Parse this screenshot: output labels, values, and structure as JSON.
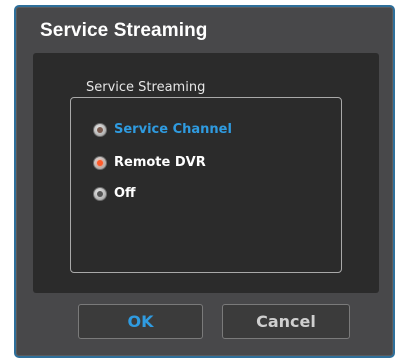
{
  "dialog": {
    "title": "Service Streaming",
    "group_label": "Service Streaming",
    "options": [
      {
        "label": "Service Channel",
        "state": "focused"
      },
      {
        "label": "Remote DVR",
        "state": "selected"
      },
      {
        "label": "Off",
        "state": "unselected"
      }
    ],
    "buttons": {
      "ok": "OK",
      "cancel": "Cancel"
    }
  },
  "colors": {
    "accent": "#2f9be0",
    "selected_dot": "#ff5a2a",
    "frame_border": "#2e6f9a"
  }
}
